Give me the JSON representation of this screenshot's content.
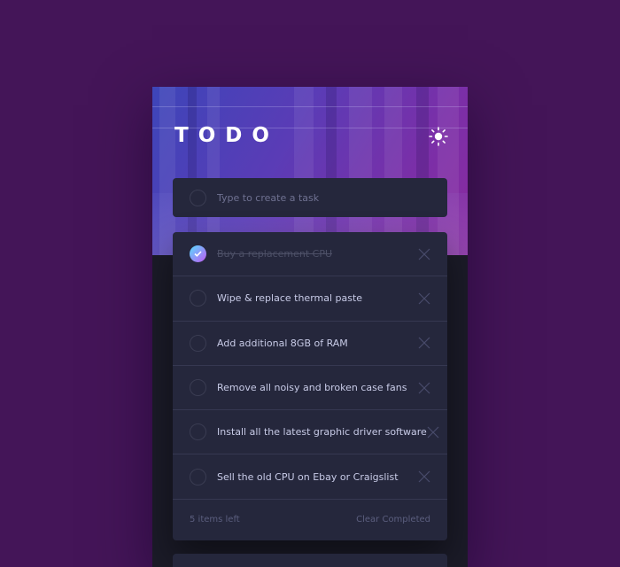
{
  "header": {
    "title": "TODO",
    "theme_icon": "sun-icon"
  },
  "new_task": {
    "placeholder": "Type to create a task",
    "value": ""
  },
  "todos": [
    {
      "text": "Buy a replacement CPU",
      "completed": true
    },
    {
      "text": "Wipe & replace thermal paste",
      "completed": false
    },
    {
      "text": "Add additional 8GB of RAM",
      "completed": false
    },
    {
      "text": "Remove all noisy and broken case fans",
      "completed": false
    },
    {
      "text": "Install all the latest graphic driver software",
      "completed": false
    },
    {
      "text": "Sell the old CPU on Ebay or Craigslist",
      "completed": false
    }
  ],
  "footer": {
    "items_left": "5 items left",
    "clear_label": "Clear Completed"
  },
  "colors": {
    "background": "#441558",
    "card": "#25273c",
    "check_gradient_start": "#57ddff",
    "check_gradient_end": "#c058f3"
  }
}
